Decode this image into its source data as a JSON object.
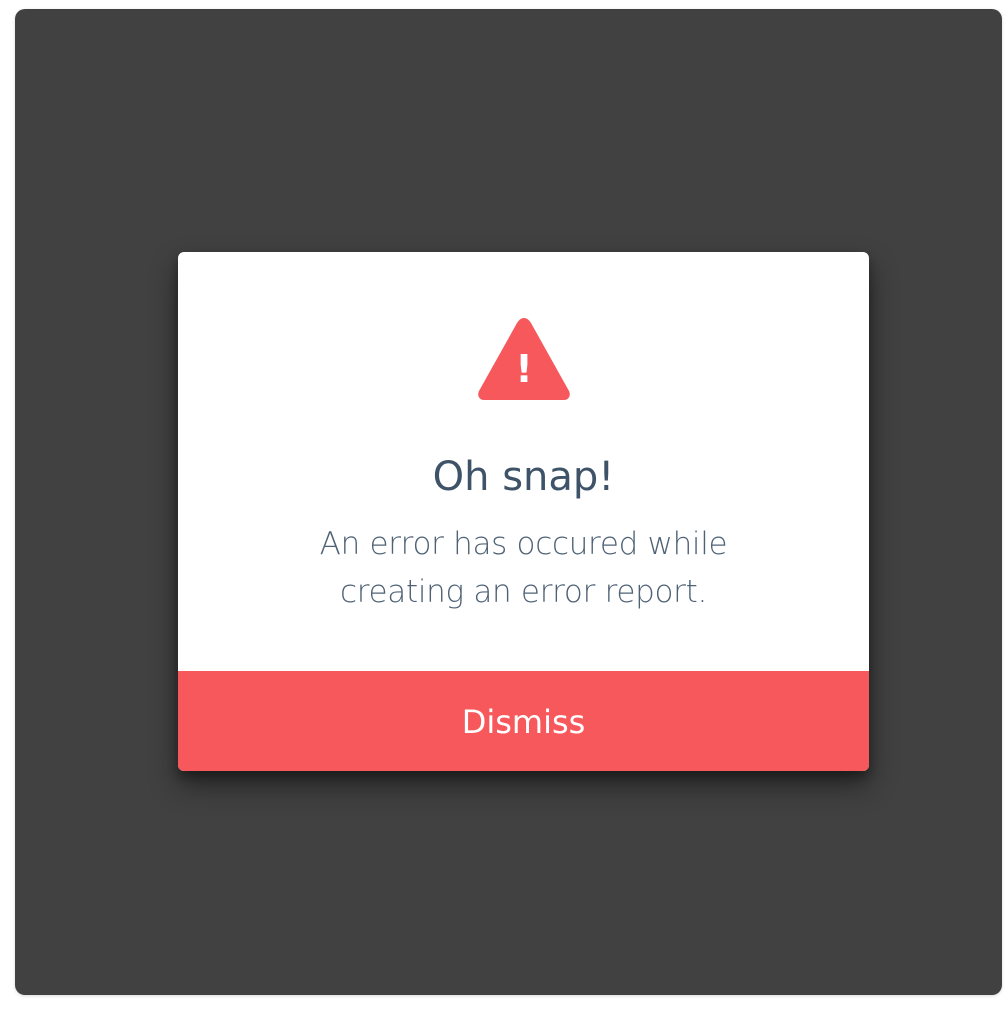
{
  "colors": {
    "backdrop": "#414141",
    "dialog_bg": "#ffffff",
    "accent": "#f7585b",
    "title": "#3e5368",
    "message": "#4f6275"
  },
  "dialog": {
    "icon": "warning-triangle-icon",
    "icon_glyph": "!",
    "title": "Oh snap!",
    "message_line1": "An error has occured while",
    "message_line2": "creating an error report.",
    "dismiss_label": "Dismiss"
  }
}
